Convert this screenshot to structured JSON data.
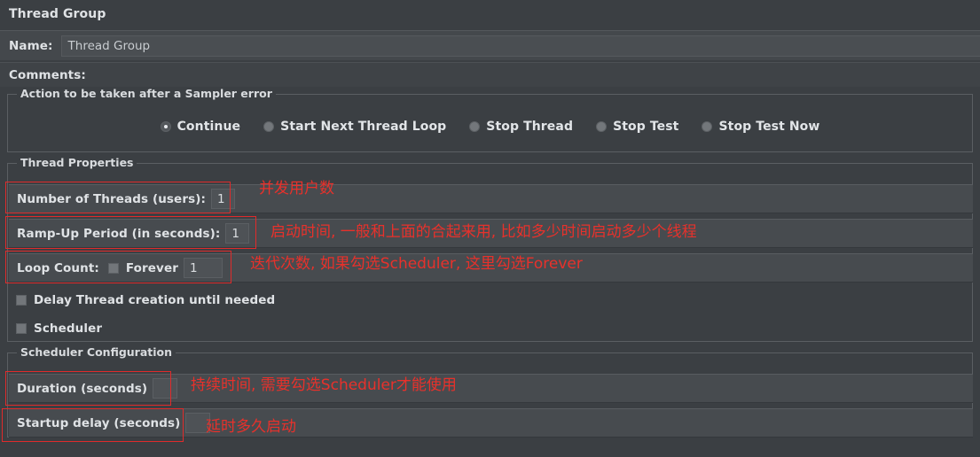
{
  "window": {
    "title": "Thread Group"
  },
  "name_row": {
    "label": "Name:",
    "value": "Thread Group"
  },
  "comments_row": {
    "label": "Comments:",
    "value": ""
  },
  "action_group": {
    "title": "Action to be taken after a Sampler error",
    "options": [
      {
        "label": "Continue",
        "selected": true
      },
      {
        "label": "Start Next Thread Loop",
        "selected": false
      },
      {
        "label": "Stop Thread",
        "selected": false
      },
      {
        "label": "Stop Test",
        "selected": false
      },
      {
        "label": "Stop Test Now",
        "selected": false
      }
    ]
  },
  "thread_properties": {
    "title": "Thread Properties",
    "number_of_threads": {
      "label": "Number of Threads (users):",
      "value": "1"
    },
    "ramp_up": {
      "label": "Ramp-Up Period (in seconds):",
      "value": "1"
    },
    "loop_count": {
      "label": "Loop Count:",
      "forever_label": "Forever",
      "forever_checked": false,
      "value": "1"
    },
    "delay_thread_creation": {
      "label": "Delay Thread creation until needed",
      "checked": false
    },
    "scheduler": {
      "label": "Scheduler",
      "checked": false
    }
  },
  "scheduler_configuration": {
    "title": "Scheduler Configuration",
    "duration": {
      "label": "Duration (seconds)",
      "value": ""
    },
    "startup_delay": {
      "label": "Startup delay (seconds)",
      "value": ""
    }
  },
  "annotations": {
    "color": "#e8312b",
    "threads": "并发用户数",
    "ramp_up": "启动时间, 一般和上面的合起来用, 比如多少时间启动多少个线程",
    "loop_count": "迭代次数, 如果勾选Scheduler, 这里勾选Forever",
    "duration": "持续时间, 需要勾选Scheduler才能使用",
    "startup_delay": "延时多久启动"
  },
  "colors": {
    "background": "#3b3f43",
    "row_background": "#474b4f",
    "field_background": "#4e5256",
    "border": "#5b5f63",
    "text": "#dfe2e5",
    "annotation_red": "#e8312b"
  }
}
